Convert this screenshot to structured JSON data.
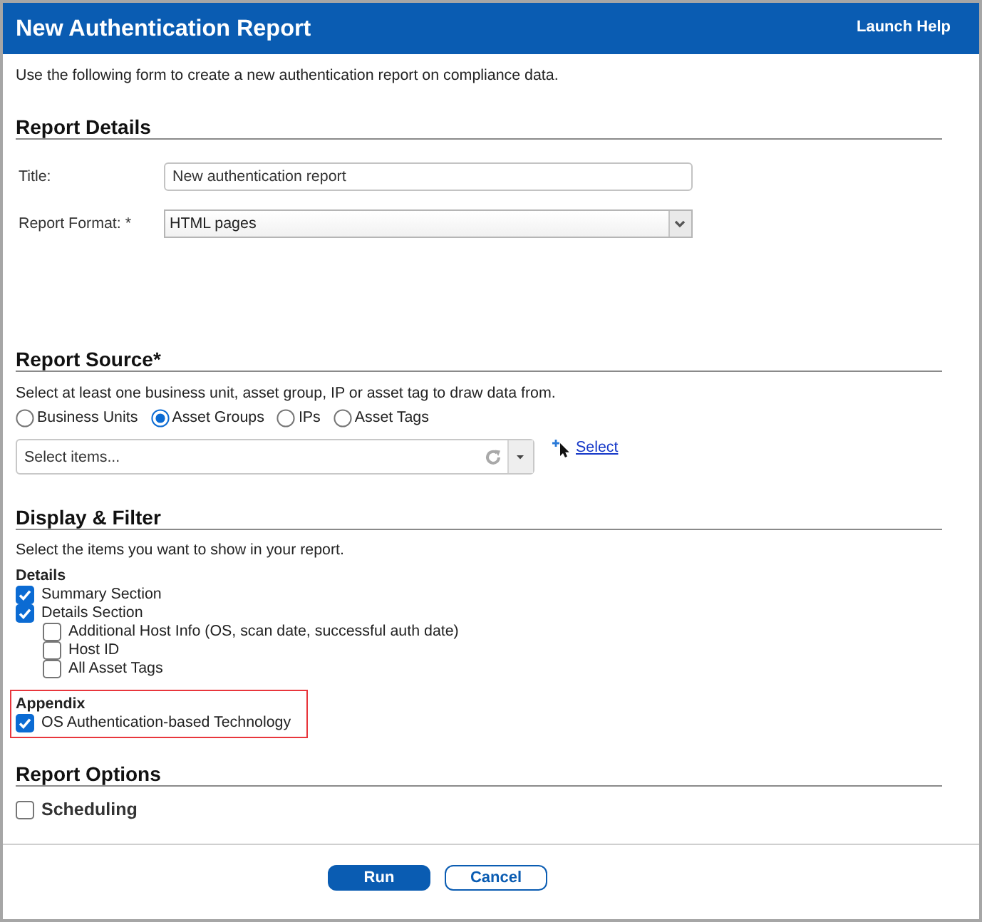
{
  "window": {
    "title": "New Authentication Report",
    "help_link": "Launch Help"
  },
  "intro": "Use the following form to create a new authentication report on compliance data.",
  "report_details": {
    "heading": "Report Details",
    "fields": [
      {
        "kind": "text",
        "label": "Title:",
        "value": "New authentication report"
      },
      {
        "kind": "select",
        "label": "Report Format: *",
        "value": "HTML pages"
      }
    ]
  },
  "report_source": {
    "heading": "Report Source*",
    "instructions": "Select at least one business unit, asset group, IP or asset tag to draw data from.",
    "options": [
      {
        "label": "Business Units",
        "selected": false
      },
      {
        "label": "Asset Groups",
        "selected": true
      },
      {
        "label": "IPs",
        "selected": false
      },
      {
        "label": "Asset Tags",
        "selected": false
      }
    ],
    "picker": {
      "placeholder": "Select items..."
    },
    "select_link": "Select"
  },
  "display_filter": {
    "heading": "Display & Filter",
    "instructions": "Select the items you want to show in your report.",
    "groups": [
      {
        "title": "Details",
        "highlighted": false,
        "items": [
          {
            "label": "Summary Section",
            "checked": true
          },
          {
            "label": "Details Section",
            "checked": true,
            "children": [
              {
                "label": "Additional Host Info (OS, scan date, successful auth date)",
                "checked": false
              },
              {
                "label": "Host ID",
                "checked": false
              },
              {
                "label": "All Asset Tags",
                "checked": false
              }
            ]
          }
        ]
      },
      {
        "title": "Appendix",
        "highlighted": true,
        "items": [
          {
            "label": "OS Authentication-based Technology",
            "checked": true
          }
        ]
      }
    ]
  },
  "report_options": {
    "heading": "Report Options",
    "items": [
      {
        "label": "Scheduling",
        "checked": false
      }
    ]
  },
  "buttons": [
    {
      "label": "Run",
      "kind": "primary"
    },
    {
      "label": "Cancel",
      "kind": "secondary"
    }
  ]
}
